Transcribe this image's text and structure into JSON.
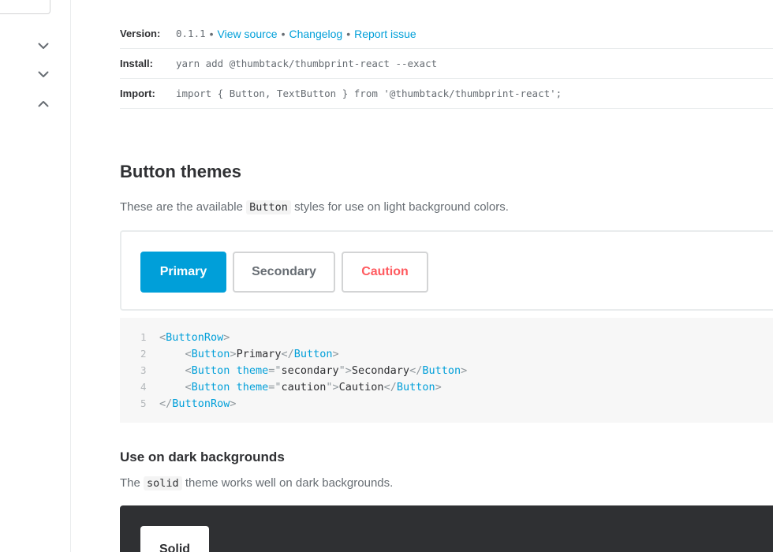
{
  "sidebar": {
    "search": {
      "placeholder": ""
    },
    "chevrons": [
      "chevron-down",
      "chevron-down",
      "chevron-up"
    ]
  },
  "meta": {
    "version_label": "Version:",
    "version_value": "0.1.1",
    "separator": "•",
    "links": [
      "View source",
      "Changelog",
      "Report issue"
    ],
    "install_label": "Install:",
    "install_value": "yarn add @thumbtack/thumbprint-react --exact",
    "import_label": "Import:",
    "import_value": "import { Button, TextButton } from '@thumbtack/thumbprint-react';"
  },
  "themes": {
    "title": "Button themes",
    "desc_pre": "These are the available",
    "desc_code": "Button",
    "desc_post": "styles for use on light background colors.",
    "buttons": {
      "primary": "Primary",
      "secondary": "Secondary",
      "caution": "Caution"
    }
  },
  "code": {
    "line_numbers": [
      "1",
      "2",
      "3",
      "4",
      "5"
    ],
    "row_tag": "ButtonRow",
    "button_tag": "Button",
    "attr": "theme",
    "secondary_value": "secondary",
    "caution_value": "caution",
    "primary_text": "Primary",
    "secondary_text": "Secondary",
    "caution_text": "Caution"
  },
  "dark": {
    "title": "Use on dark backgrounds",
    "desc_pre": "The",
    "desc_code": "solid",
    "desc_post": "theme works well on dark backgrounds.",
    "solid_label": "Solid"
  },
  "colors": {
    "accent": "#009fd9",
    "caution": "#ff5a5f",
    "text": "#2f3033",
    "muted": "#676d73",
    "dark_bg": "#2f3033"
  }
}
